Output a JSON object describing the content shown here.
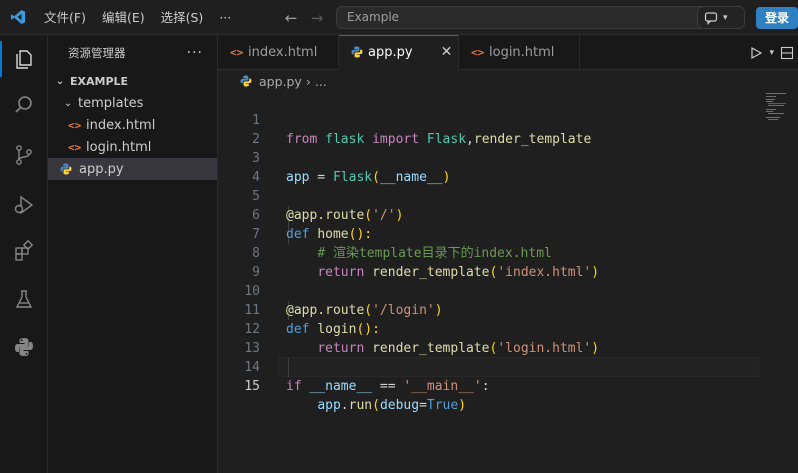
{
  "titlebar": {
    "menu": [
      "文件(F)",
      "编辑(E)",
      "选择(S)",
      "···"
    ],
    "search_placeholder": "Example",
    "login_label": "登录"
  },
  "sidebar": {
    "title": "资源管理器",
    "more": "···",
    "section": "EXAMPLE",
    "folder": "templates",
    "files": [
      {
        "name": "index.html",
        "type": "html"
      },
      {
        "name": "login.html",
        "type": "html"
      }
    ],
    "root_file": "app.py"
  },
  "tabs": [
    {
      "label": "index.html",
      "type": "html",
      "active": false
    },
    {
      "label": "app.py",
      "type": "py",
      "active": true
    },
    {
      "label": "login.html",
      "type": "html",
      "active": false
    }
  ],
  "breadcrumb": {
    "file": "app.py",
    "rest": "..."
  },
  "editor": {
    "line_numbers": [
      "1",
      "2",
      "3",
      "4",
      "5",
      "6",
      "7",
      "8",
      "9",
      "10",
      "11",
      "12",
      "13",
      "14",
      "15"
    ],
    "current_line": 15,
    "lines": {
      "l1": {
        "from": "from",
        "mod": "flask",
        "import": "import",
        "cls": "Flask",
        "comma": ",",
        "fn": "render_template"
      },
      "l3": {
        "var": "app",
        "eq": " = ",
        "cls": "Flask",
        "open": "(",
        "name": "__name__",
        "close": ")"
      },
      "l5": {
        "dec": "@app.route",
        "open": "(",
        "str": "'/'",
        "close": ")"
      },
      "l6": {
        "kw": "def",
        "fn": "home",
        "parens": "():",
        "colon": ""
      },
      "l7": {
        "comment": "# 渲染template目录下的index.html"
      },
      "l8": {
        "kw": "return",
        "fn": "render_template",
        "open": "(",
        "str": "'index.html'",
        "close": ")"
      },
      "l10": {
        "dec": "@app.route",
        "open": "(",
        "str": "'/login'",
        "close": ")"
      },
      "l11": {
        "kw": "def",
        "fn": "login",
        "parens": "():"
      },
      "l12": {
        "kw": "return",
        "fn": "render_template",
        "open": "(",
        "str": "'login.html'",
        "close": ")"
      },
      "l14": {
        "kw": "if",
        "name": "__name__",
        "op": " == ",
        "str": "'__main__'",
        "colon": ":"
      },
      "l15": {
        "var": "app",
        "dot": ".",
        "fn": "run",
        "open": "(",
        "param": "debug",
        "eq": "=",
        "const": "True",
        "close": ")"
      }
    }
  },
  "colors": {
    "accent": "#0078d4",
    "login_button": "#2f7fc3",
    "keyword": "#c586c0",
    "function": "#dcdcaa",
    "class": "#4ec9b0",
    "string": "#ce9178",
    "comment": "#6a9955"
  },
  "icons": {
    "activity": [
      "explorer-icon",
      "search-icon",
      "source-control-icon",
      "run-debug-icon",
      "extensions-icon",
      "testing-icon",
      "python-icon"
    ]
  }
}
